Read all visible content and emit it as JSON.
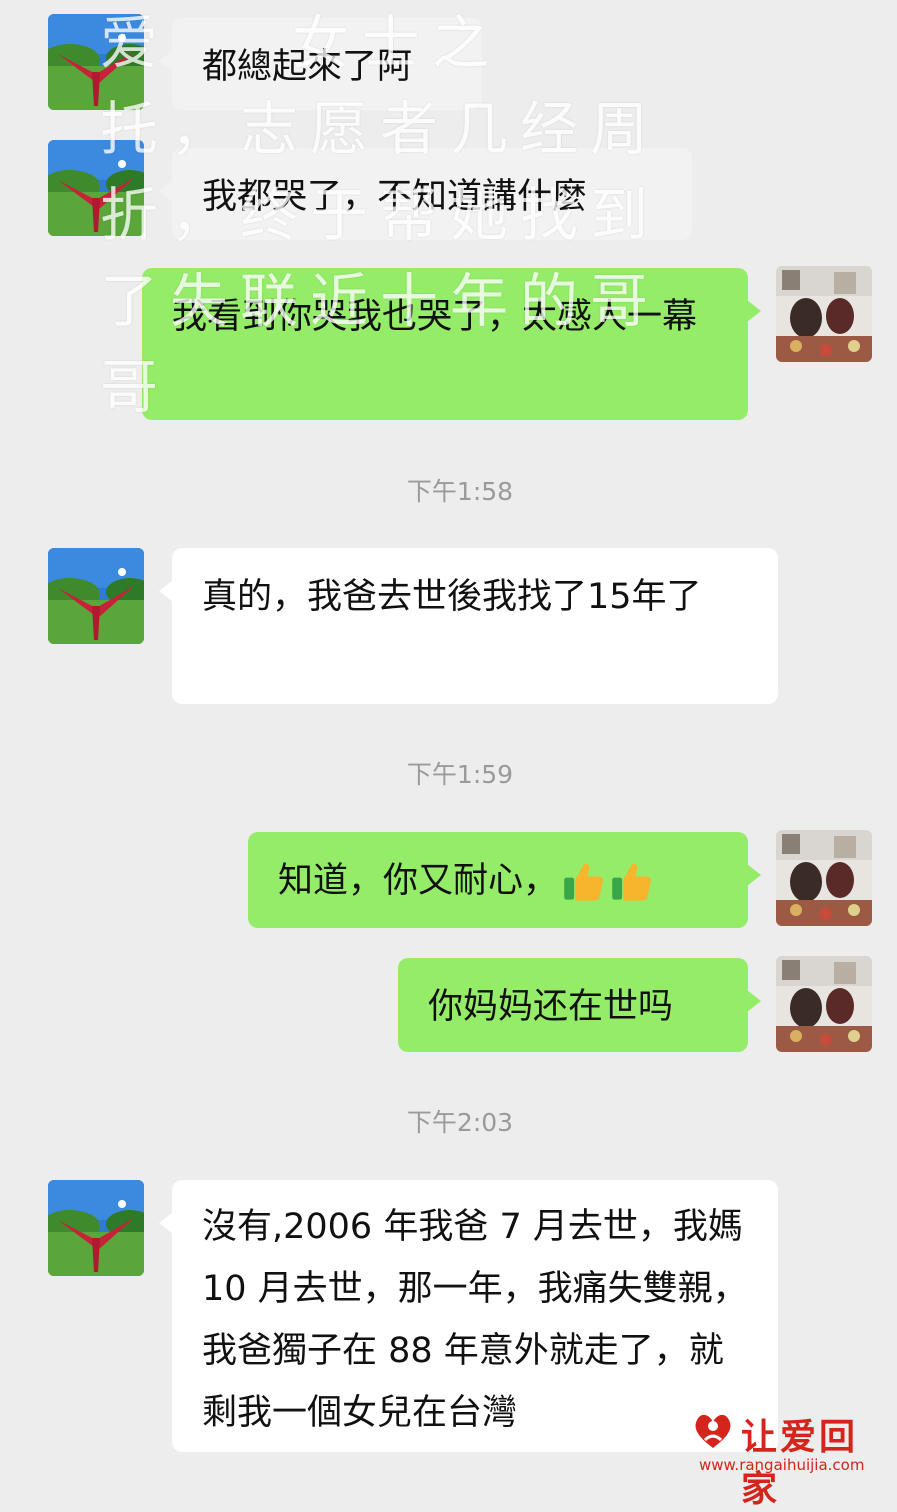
{
  "messages": [
    {
      "side": "in",
      "text": "都總起來了阿"
    },
    {
      "side": "in",
      "text": "我都哭了，不知道講什麼"
    },
    {
      "side": "out",
      "text": "我看到你哭我也哭了，太感人一幕"
    },
    {
      "time": "下午1:58"
    },
    {
      "side": "in",
      "text": "真的，我爸去世後我找了15年了"
    },
    {
      "time": "下午1:59"
    },
    {
      "side": "out",
      "text": "知道，你又耐心，"
    },
    {
      "side": "out",
      "text": "你妈妈还在世吗"
    },
    {
      "time": "下午2:03"
    },
    {
      "side": "in",
      "text": "沒有,2006 年我爸 7 月去世，我媽 10 月去世，那一年，我痛失雙親，我爸獨子在 88 年意外就走了，就剩我一個女兒在台灣"
    }
  ],
  "overlay_text": "爱    女士之\n托，志愿者几经周\n折，终于帮她找到\n了失联近十年的哥\n哥",
  "watermark": {
    "title": "让爱回家",
    "url": "www.rangaihuijia.com",
    "color": "#d4241c"
  },
  "colors": {
    "background": "#ededed",
    "incoming_bubble": "#ffffff",
    "outgoing_bubble": "#95ec69",
    "timestamp": "#9a9a9a"
  },
  "icons": {
    "thumbs_up": "thumbs-up-icon",
    "contact_avatar": "landscape-avatar",
    "self_avatar": "restaurant-photo-avatar"
  }
}
